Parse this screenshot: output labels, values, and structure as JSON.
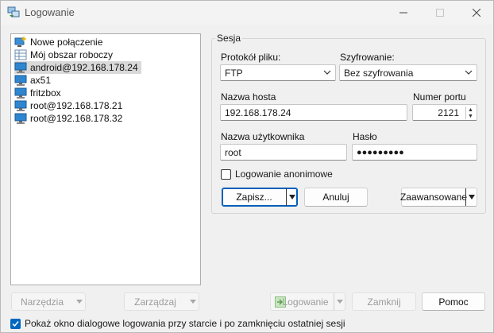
{
  "window": {
    "title": "Logowanie"
  },
  "tree": {
    "items": [
      {
        "label": "Nowe połączenie",
        "icon": "new-connection-icon"
      },
      {
        "label": "Mój obszar roboczy",
        "icon": "workspace-icon"
      },
      {
        "label": "android@192.168.178.24",
        "icon": "computer-icon",
        "selected": true
      },
      {
        "label": "ax51",
        "icon": "computer-icon"
      },
      {
        "label": "fritzbox",
        "icon": "computer-icon"
      },
      {
        "label": "root@192.168.178.21",
        "icon": "computer-icon"
      },
      {
        "label": "root@192.168.178.32",
        "icon": "computer-icon"
      }
    ]
  },
  "session": {
    "legend": "Sesja",
    "protocol_label": "Protokół pliku:",
    "protocol_value": "FTP",
    "encryption_label": "Szyfrowanie:",
    "encryption_value": "Bez szyfrowania",
    "host_label": "Nazwa hosta",
    "host_value": "192.168.178.24",
    "port_label": "Numer portu",
    "port_value": "2121",
    "user_label": "Nazwa użytkownika",
    "user_value": "root",
    "password_label": "Hasło",
    "password_value": "●●●●●●●●●",
    "anonymous_label": "Logowanie anonimowe",
    "anonymous_checked": false,
    "save_label": "Zapisz...",
    "cancel_label": "Anuluj",
    "advanced_label": "Zaawansowane"
  },
  "bottom": {
    "tools_label": "Narzędzia",
    "manage_label": "Zarządzaj",
    "login_label": "Logowanie",
    "close_label": "Zamknij",
    "help_label": "Pomoc",
    "show_dialog_label": "Pokaż okno dialogowe logowania przy starcie i po zamknięciu ostatniej sesji",
    "show_dialog_checked": true
  },
  "colors": {
    "accent": "#0067c0",
    "selection": "#d9d9d9",
    "background": "#f0f0f0"
  }
}
